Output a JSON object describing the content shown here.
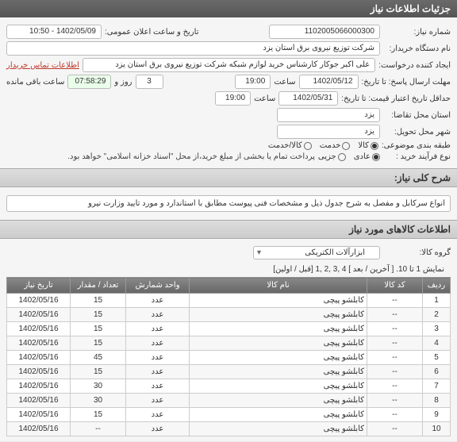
{
  "header": {
    "title": "جزئیات اطلاعات نیاز"
  },
  "fields": {
    "reqno_label": "شماره نیاز:",
    "reqno": "1102005066000300",
    "pubdate_label": "تاریخ و ساعت اعلان عمومی:",
    "pubdate": "1402/05/09 - 10:50",
    "buyer_label": "نام دستگاه خریدار:",
    "buyer": "شرکت توزیع نیروی برق استان یزد",
    "creator_label": "ایجاد کننده درخواست:",
    "creator": "علی اکبر جوکار  کارشناس خرید لوازم شبکه  شرکت توزیع نیروی برق استان یزد",
    "contact_link": "اطلاعات تماس خریدار",
    "deadline_label": "مهلت ارسال پاسخ: تا تاریخ:",
    "deadline_date": "1402/05/12",
    "time_label": "ساعت",
    "deadline_time": "19:00",
    "days_label": "روز و",
    "days": "3",
    "remain_time": "07:58:29",
    "remain_label": "ساعت باقی مانده",
    "validity_label": "حداقل تاریخ اعتبار قیمت: تا تاریخ:",
    "validity_date": "1402/05/31",
    "validity_time": "19:00",
    "reqloc_label": "استان محل تقاضا:",
    "reqloc": "یزد",
    "delloc_label": "شهر محل تحویل:",
    "delloc": "یزد",
    "subject_label": "طبقه بندی موضوعی:",
    "type_goods": "کالا",
    "type_service": "خدمت",
    "type_goodsservice": "کالا/خدمت",
    "process_label": "نوع فرآیند خرید :",
    "process_normal": "عادی",
    "process_partial": "جزیی",
    "process_note": "پرداخت تمام یا بخشی از مبلغ خرید،از محل \"اسناد خزانه اسلامی\" خواهد بود."
  },
  "general": {
    "title": "شرح کلی نیاز:",
    "desc": "انواع سرکابل و مفصل به شرح جدول ذیل و مشخصات فنی پیوست مطابق با استاندارد و مورد تایید وزارت نیرو"
  },
  "items": {
    "section_title": "اطلاعات کالاهای مورد نیاز",
    "group_label": "گروه کالا:",
    "group": "ابزارآلات الکتریکی",
    "pager_text": "نمایش 1 تا 10.",
    "pager_links": "[ آخرین / بعد ] 4 ,3 ,2 ,1 [قبل / اولین]",
    "cols": {
      "idx": "ردیف",
      "code": "کد کالا",
      "name": "نام کالا",
      "unit": "واحد شمارش",
      "qty": "تعداد / مقدار",
      "date": "تاریخ نیاز"
    },
    "rows": [
      {
        "idx": "1",
        "code": "--",
        "name": "کابلشو پیچی",
        "unit": "عدد",
        "qty": "15",
        "date": "1402/05/16"
      },
      {
        "idx": "2",
        "code": "--",
        "name": "کابلشو پیچی",
        "unit": "عدد",
        "qty": "15",
        "date": "1402/05/16"
      },
      {
        "idx": "3",
        "code": "--",
        "name": "کابلشو پیچی",
        "unit": "عدد",
        "qty": "15",
        "date": "1402/05/16"
      },
      {
        "idx": "4",
        "code": "--",
        "name": "کابلشو پیچی",
        "unit": "عدد",
        "qty": "15",
        "date": "1402/05/16"
      },
      {
        "idx": "5",
        "code": "--",
        "name": "کابلشو پیچی",
        "unit": "عدد",
        "qty": "45",
        "date": "1402/05/16"
      },
      {
        "idx": "6",
        "code": "--",
        "name": "کابلشو پیچی",
        "unit": "عدد",
        "qty": "15",
        "date": "1402/05/16"
      },
      {
        "idx": "7",
        "code": "--",
        "name": "کابلشو پیچی",
        "unit": "عدد",
        "qty": "30",
        "date": "1402/05/16"
      },
      {
        "idx": "8",
        "code": "--",
        "name": "کابلشو پیچی",
        "unit": "عدد",
        "qty": "30",
        "date": "1402/05/16"
      },
      {
        "idx": "9",
        "code": "--",
        "name": "کابلشو پیچی",
        "unit": "عدد",
        "qty": "15",
        "date": "1402/05/16"
      },
      {
        "idx": "10",
        "code": "--",
        "name": "کابلشو پیچی",
        "unit": "عدد",
        "qty": "--",
        "date": "1402/05/16"
      }
    ]
  }
}
